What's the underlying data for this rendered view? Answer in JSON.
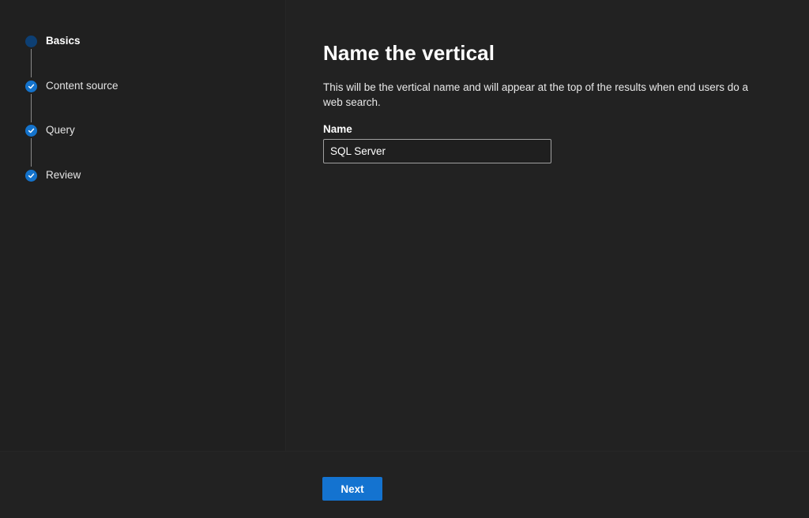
{
  "wizard": {
    "steps": [
      {
        "label": "Basics",
        "state": "current"
      },
      {
        "label": "Content source",
        "state": "completed"
      },
      {
        "label": "Query",
        "state": "completed"
      },
      {
        "label": "Review",
        "state": "completed"
      }
    ]
  },
  "main": {
    "title": "Name the vertical",
    "description": "This will be the vertical name and will appear at the top of the results when end users do a web search.",
    "name_label": "Name",
    "name_value": "SQL Server"
  },
  "footer": {
    "next_label": "Next"
  },
  "colors": {
    "accent": "#1473d0",
    "current_step": "#0d3f73",
    "background": "#222222"
  }
}
